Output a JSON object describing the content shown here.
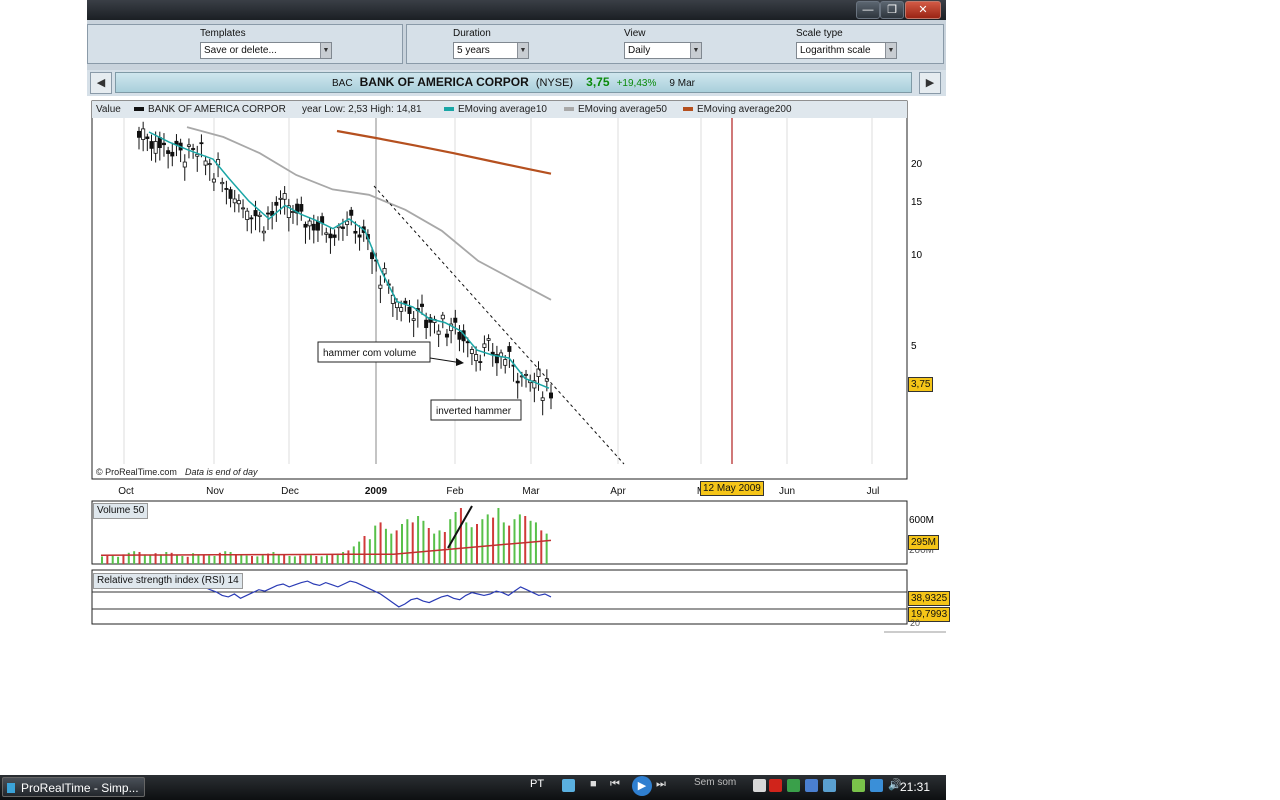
{
  "window": {
    "minimize_glyph": "—",
    "restore_glyph": "❐",
    "close_glyph": "✕"
  },
  "toolbar": {
    "templates": {
      "label": "Templates",
      "value": "Save or delete..."
    },
    "duration": {
      "label": "Duration",
      "value": "5 years"
    },
    "view": {
      "label": "View",
      "value": "Daily"
    },
    "scale": {
      "label": "Scale type",
      "value": "Logarithm scale"
    }
  },
  "quote": {
    "ticker": "BAC",
    "name": "BANK OF AMERICA CORPOR",
    "exchange": "(NYSE)",
    "price": "3,75",
    "change": "+19,43%",
    "date": "9 Mar"
  },
  "legend": {
    "value_label": "Value",
    "series_name": "BANK OF AMERICA CORPOR",
    "year_range": "year Low: 2,53 High: 14,81",
    "ema10": "EMoving average10",
    "ema50": "EMoving average50",
    "ema200": "EMoving average200"
  },
  "colors": {
    "price": "#111111",
    "ema10": "#1aa6a6",
    "ema50": "#a8a8a8",
    "ema200": "#b5501f",
    "volume_up": "#58c04a",
    "volume_down": "#d03a3a",
    "volume_avg": "#c23030",
    "rsi": "#2a3bb5",
    "cursor": "#b02020",
    "highlight": "#f5c518"
  },
  "chart_data": [
    {
      "type": "line",
      "title": "",
      "price_ticks": [
        "20",
        "15",
        "10",
        "5"
      ],
      "x_ticks": [
        "Oct",
        "Nov",
        "Dec",
        "2009",
        "Feb",
        "Mar",
        "Apr",
        "M",
        "Jun",
        "Jul"
      ],
      "scale": "log",
      "current_price_label": "3,75",
      "cursor_date_label": "12 May 2009",
      "credit": "© ProRealTime.com",
      "credit_note": "Data is end of day",
      "annotations": [
        {
          "text": "hammer com volume"
        },
        {
          "text": "inverted hammer"
        }
      ],
      "series": [
        {
          "name": "EMoving average10",
          "x": [
            0.0,
            0.05,
            0.1,
            0.16,
            0.2,
            0.25,
            0.3,
            0.34,
            0.38,
            0.42,
            0.46,
            0.5,
            0.54,
            0.58,
            0.62,
            0.66,
            0.7,
            0.74,
            0.78,
            0.82,
            0.86,
            0.9,
            0.94,
            1.0
          ],
          "y": [
            27,
            25,
            23.5,
            22,
            19,
            16,
            14,
            15.5,
            14.5,
            13.8,
            13,
            14,
            12.8,
            9.5,
            7.5,
            7.2,
            6.6,
            6.4,
            6.0,
            5.2,
            5.0,
            4.9,
            4.2,
            3.9
          ]
        },
        {
          "name": "EMoving average50",
          "x": [
            0.0,
            0.1,
            0.2,
            0.3,
            0.4,
            0.5,
            0.6,
            0.7,
            0.8,
            0.9,
            1.0
          ],
          "y": [
            28,
            26,
            23,
            19.5,
            17.5,
            16.8,
            15,
            12.8,
            10.2,
            8.8,
            7.6
          ]
        },
        {
          "name": "EMoving average200",
          "x": [
            0.45,
            0.55,
            0.65,
            0.75,
            0.85,
            0.95,
            1.0
          ],
          "y": [
            27.2,
            25.8,
            24.4,
            23.0,
            21.6,
            20.3,
            19.7
          ]
        }
      ]
    },
    {
      "type": "bar",
      "title": "Volume 50",
      "y_ticks": [
        "600M",
        "200M"
      ],
      "current_value_label": "295M",
      "volumes_m": [
        95,
        100,
        110,
        90,
        120,
        140,
        160,
        150,
        120,
        110,
        135,
        120,
        150,
        140,
        110,
        100,
        90,
        135,
        120,
        110,
        105,
        100,
        140,
        160,
        150,
        125,
        110,
        105,
        100,
        95,
        110,
        130,
        150,
        120,
        115,
        100,
        95,
        105,
        120,
        110,
        100,
        95,
        110,
        120,
        130,
        150,
        170,
        220,
        280,
        350,
        310,
        480,
        520,
        440,
        380,
        420,
        500,
        560,
        520,
        600,
        540,
        450,
        380,
        420,
        400,
        560,
        650,
        700,
        520,
        460,
        500,
        560,
        620,
        580,
        700,
        520,
        480,
        560,
        620,
        600,
        540,
        520,
        420,
        380
      ],
      "avg_start_m": 110,
      "avg_end_m": 295
    },
    {
      "type": "line",
      "title": "Relative strength index (RSI) 14",
      "levels": [
        "38,9325",
        "19,7993"
      ],
      "y_ticks": [
        "20"
      ],
      "values": [
        50,
        55,
        60,
        58,
        56,
        60,
        57,
        55,
        53,
        58,
        56,
        52,
        48,
        45,
        40,
        38,
        42,
        36,
        40,
        44,
        48,
        46,
        50,
        54,
        56,
        52,
        55,
        58,
        60,
        56,
        54,
        58,
        55,
        52,
        56,
        60,
        58,
        54,
        50,
        46,
        42,
        36,
        30,
        24,
        28,
        34,
        36,
        32,
        30,
        34,
        38,
        40,
        36,
        34,
        40,
        44,
        42,
        40,
        42,
        46,
        44,
        40,
        46,
        52,
        48,
        44,
        40,
        42,
        38
      ]
    }
  ],
  "taskbar": {
    "app_title": "ProRealTime - Simp...",
    "language": "PT",
    "media_text": "Sem som",
    "clock": "21:31"
  }
}
